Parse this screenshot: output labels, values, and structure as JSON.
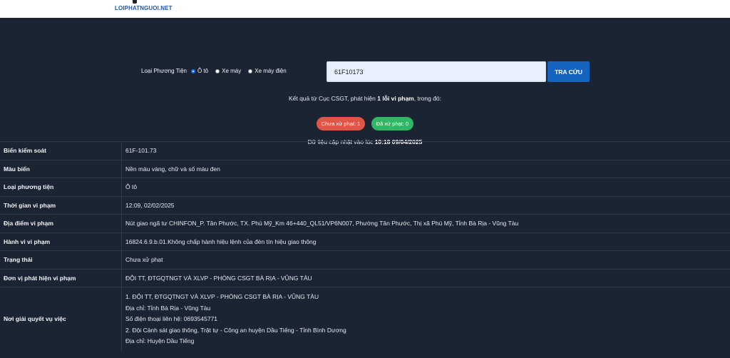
{
  "header": {
    "logo_text": "LOIPHATNGUOI.NET"
  },
  "search": {
    "vehicle_type_label": "Loại Phương Tiện",
    "options": [
      "Ô tô",
      "Xe máy",
      "Xe máy điện"
    ],
    "selected": "Ô tô",
    "plate_value": "61F10173",
    "button_label": "TRA CỨU"
  },
  "result": {
    "prefix": "Kết quả từ Cục CSGT, phát hiện ",
    "count_text": "1 lỗi vi phạm",
    "suffix": ", trong đó:",
    "badge_unpaid": "Chưa xử phạt: 1",
    "badge_paid": "Đã xử phạt: 0",
    "update_prefix": "Dữ liệu cập nhật vào lúc ",
    "update_time": "10:18 09/04/2025"
  },
  "colors": {
    "unpaid": "#e05545",
    "paid": "#2fb765",
    "button": "#1565c0",
    "background": "#1b2433"
  },
  "details": {
    "plate_label": "Biển kiểm soát",
    "plate_value": "61F-101.73",
    "color_label": "Màu biển",
    "color_value": "Nền màu vàng, chữ và số màu đen",
    "type_label": "Loại phương tiện",
    "type_value": "Ô tô",
    "time_label": "Thời gian vi phạm",
    "time_value": "12:09, 02/02/2025",
    "location_label": "Địa điểm vi phạm",
    "location_value": "Nút giao ngã tư CHINFON_P. Tân Phước, TX. Phú Mỹ_Km 46+440_QL51/VP6N007, Phường Tân Phước, Thị xã Phú Mỹ, Tỉnh Bà Rịa - Vũng Tàu",
    "violation_label": "Hành vi vi phạm",
    "violation_value": "16824.6.9.b.01.Không chấp hành hiệu lệnh của đèn tín hiệu giao thông",
    "status_label": "Trạng thái",
    "status_value": "Chưa xử phạt",
    "unit_label": "Đơn vị phát hiện vi phạm",
    "unit_value": "ĐỘI TT, ĐTGQTNGT VÀ XLVP - PHÒNG CSGT BÀ RỊA - VŨNG TÀU",
    "resolve_label": "Nơi giải quyết vụ việc",
    "resolve_lines": [
      "1. ĐỘI TT, ĐTGQTNGT VÀ XLVP - PHÒNG CSGT BÀ RỊA - VŨNG TÀU",
      "Địa chỉ: Tỉnh Bà Rịa - Vũng Tàu",
      "Số điện thoại liên hệ: 0693545771",
      "2. Đội Cảnh sát giao thông, Trật tự - Công an huyện Dầu Tiếng - Tỉnh Bình Dương",
      "Địa chỉ: Huyện Dầu Tiếng"
    ]
  }
}
